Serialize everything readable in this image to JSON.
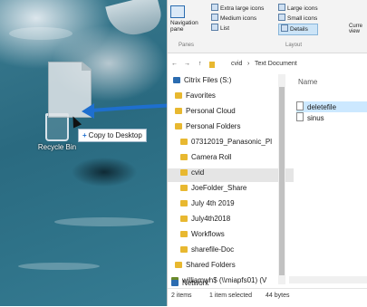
{
  "desktop": {
    "recycle_bin_label": "Recycle Bin",
    "drag_tooltip": "Copy to Desktop",
    "tooltip_icon": "+"
  },
  "ribbon": {
    "navigation_pane": "Navigation pane",
    "extra_large_icons": "Extra large icons",
    "large_icons": "Large icons",
    "medium_icons": "Medium icons",
    "small_icons": "Small icons",
    "list": "List",
    "details": "Details",
    "panes_group": "Panes",
    "layout_group": "Layout",
    "current_view": "Curre view"
  },
  "address": {
    "back": "←",
    "forward": "→",
    "up": "↑",
    "crumb1": "cvid",
    "sep": "›",
    "crumb2": "Text Document"
  },
  "nav_tree": [
    {
      "label": "Citrix Files (S:)",
      "icon": "drive-icon",
      "color": "#2b6cb0"
    },
    {
      "label": "Favorites",
      "icon": "folder-icon",
      "color": "#e8b830"
    },
    {
      "label": "Personal Cloud",
      "icon": "folder-icon",
      "color": "#e8b830"
    },
    {
      "label": "Personal Folders",
      "icon": "folder-icon",
      "color": "#e8b830"
    },
    {
      "label": "07312019_Panasonic_Pl",
      "icon": "folder-icon",
      "color": "#e8b830"
    },
    {
      "label": "Camera Roll",
      "icon": "folder-icon",
      "color": "#e8b830"
    },
    {
      "label": "cvid",
      "icon": "folder-icon",
      "color": "#e8b830",
      "selected": true
    },
    {
      "label": "JoeFolder_Share",
      "icon": "folder-icon",
      "color": "#e8b830"
    },
    {
      "label": "July 4th 2019",
      "icon": "folder-icon",
      "color": "#e8b830"
    },
    {
      "label": "July4th2018",
      "icon": "folder-icon",
      "color": "#e8b830"
    },
    {
      "label": "Workflows",
      "icon": "folder-icon",
      "color": "#e8b830"
    },
    {
      "label": "sharefile-Doc",
      "icon": "folder-icon",
      "color": "#e8b830"
    },
    {
      "label": "Shared Folders",
      "icon": "folder-icon",
      "color": "#e8b830"
    },
    {
      "label": "williamwh$ (\\\\miapfs01) (V",
      "icon": "network-drive-icon",
      "color": "#6a8a2a"
    },
    {
      "label": "Network",
      "icon": "network-icon",
      "color": "#2b6cb0"
    }
  ],
  "file_pane": {
    "column_name": "Name",
    "files": [
      {
        "label": "deletefile",
        "selected": true
      },
      {
        "label": "sinus",
        "selected": false
      }
    ]
  },
  "status": {
    "items": "2 items",
    "selected": "1 item selected",
    "size": "44 bytes"
  },
  "colors": {
    "accent": "#1e6fcf",
    "selection": "#cce8ff",
    "folder": "#e8b830"
  }
}
